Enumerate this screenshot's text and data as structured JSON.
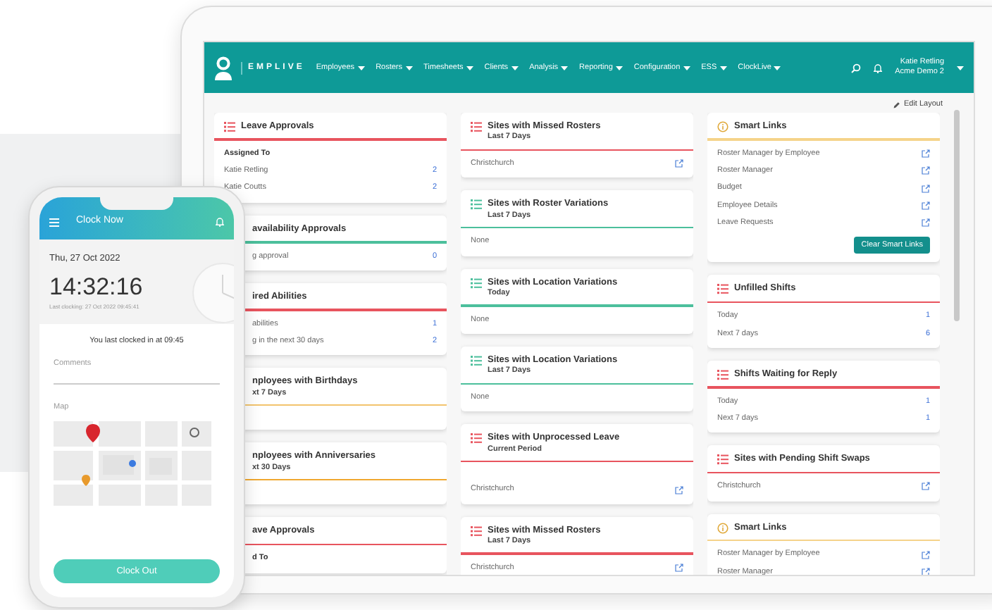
{
  "header": {
    "logo": "EMPLIVE",
    "nav": [
      "Employees",
      "Rosters",
      "Timesheets",
      "Clients",
      "Analysis",
      "Reporting",
      "Configuration",
      "ESS",
      "ClockLive"
    ],
    "user": "Katie Retling",
    "org": "Acme Demo 2"
  },
  "edit_layout": "Edit Layout",
  "columns": [
    [
      {
        "kind": "list",
        "color": "#e8545e",
        "covered": false,
        "title": "Leave Approvals",
        "rows": [
          {
            "kind": "heading",
            "label": "Assigned To"
          },
          {
            "kind": "count",
            "label": "Katie Retling",
            "value": "2"
          },
          {
            "kind": "count",
            "label": "Katie Coutts",
            "value": "2"
          }
        ]
      },
      {
        "color": "#4cbf9c",
        "covered": true,
        "title": "availability Approvals",
        "rows": [
          {
            "kind": "count",
            "label": "g approval",
            "value": "0"
          }
        ]
      },
      {
        "color": "#e8545e",
        "covered": true,
        "title": "ired Abilities",
        "rows": [
          {
            "kind": "count",
            "label": "abilities",
            "value": "1"
          },
          {
            "kind": "count",
            "label": "g in the next 30 days",
            "value": "2"
          }
        ]
      },
      {
        "color": "#f2c46d",
        "covered": true,
        "title": "nployees with Birthdays",
        "subtitle": "xt 7 Days",
        "rows": [
          {
            "kind": "blank"
          }
        ]
      },
      {
        "color": "#f0a830",
        "covered": true,
        "title": "nployees with Anniversaries",
        "subtitle": "xt 30 Days",
        "rows": [
          {
            "kind": "blank"
          }
        ]
      },
      {
        "color": "#e8545e",
        "covered": true,
        "title": "ave Approvals",
        "rows": [
          {
            "kind": "heading",
            "label": "d To"
          }
        ]
      }
    ],
    [
      {
        "kind": "list",
        "color": "#e8545e",
        "covered": false,
        "title": "Sites with Missed Rosters",
        "subtitle": "Last 7 Days",
        "rows": [
          {
            "kind": "link",
            "label": "Christchurch"
          }
        ]
      },
      {
        "kind": "list",
        "color": "#4cbf9c",
        "covered": false,
        "title": "Sites with Roster Variations",
        "subtitle": "Last 7 Days",
        "rows": [
          {
            "kind": "text",
            "label": "None"
          }
        ]
      },
      {
        "kind": "list",
        "color": "#4cbf9c",
        "covered": false,
        "title": "Sites with Location Variations",
        "subtitle": "Today",
        "rows": [
          {
            "kind": "text",
            "label": "None"
          }
        ]
      },
      {
        "kind": "list",
        "color": "#4cbf9c",
        "covered": false,
        "title": "Sites with Location Variations",
        "subtitle": "Last 7 Days",
        "rows": [
          {
            "kind": "text",
            "label": "None"
          }
        ]
      },
      {
        "kind": "list",
        "color": "#e8545e",
        "covered": false,
        "title": "Sites with Unprocessed Leave",
        "subtitle": "Current Period",
        "rows": [
          {
            "kind": "blank"
          },
          {
            "kind": "link",
            "label": "Christchurch"
          }
        ]
      },
      {
        "kind": "list",
        "color": "#e8545e",
        "covered": false,
        "title": "Sites with Missed Rosters",
        "subtitle": "Last 7 Days",
        "rows": [
          {
            "kind": "link",
            "label": "Christchurch"
          }
        ]
      }
    ],
    [
      {
        "kind": "info",
        "color": "#f5d38a",
        "covered": false,
        "title": "Smart Links",
        "rows": [
          {
            "kind": "link",
            "label": "Roster Manager by Employee"
          },
          {
            "kind": "link",
            "label": "Roster Manager"
          },
          {
            "kind": "link",
            "label": "Budget"
          },
          {
            "kind": "link",
            "label": "Employee Details"
          },
          {
            "kind": "link",
            "label": "Leave Requests"
          }
        ],
        "button": "Clear Smart Links"
      },
      {
        "kind": "list",
        "color": "#e8545e",
        "covered": false,
        "title": "Unfilled Shifts",
        "rows": [
          {
            "kind": "count",
            "label": "Today",
            "value": "1"
          },
          {
            "kind": "count",
            "label": "Next 7 days",
            "value": "6"
          }
        ]
      },
      {
        "kind": "list",
        "color": "#e8545e",
        "covered": false,
        "title": "Shifts Waiting for Reply",
        "rows": [
          {
            "kind": "count",
            "label": "Today",
            "value": "1"
          },
          {
            "kind": "count",
            "label": "Next 7 days",
            "value": "1"
          }
        ]
      },
      {
        "kind": "list",
        "color": "#e8545e",
        "covered": false,
        "title": "Sites with Pending Shift Swaps",
        "rows": [
          {
            "kind": "link",
            "label": "Christchurch"
          }
        ]
      },
      {
        "kind": "info",
        "color": "#f5d38a",
        "covered": false,
        "title": "Smart Links",
        "rows": [
          {
            "kind": "link",
            "label": "Roster Manager by Employee"
          },
          {
            "kind": "link",
            "label": "Roster Manager"
          }
        ]
      }
    ]
  ],
  "phone": {
    "title": "Clock Now",
    "date": "Thu, 27 Oct 2022",
    "time": "14:32:16",
    "last_clocking": "Last clocking: 27 Oct 2022 09:45:41",
    "message": "You last clocked in at 09:45",
    "comments": {
      "placeholder": "Comments"
    },
    "map_label": "Map",
    "button": "Clock Out"
  }
}
